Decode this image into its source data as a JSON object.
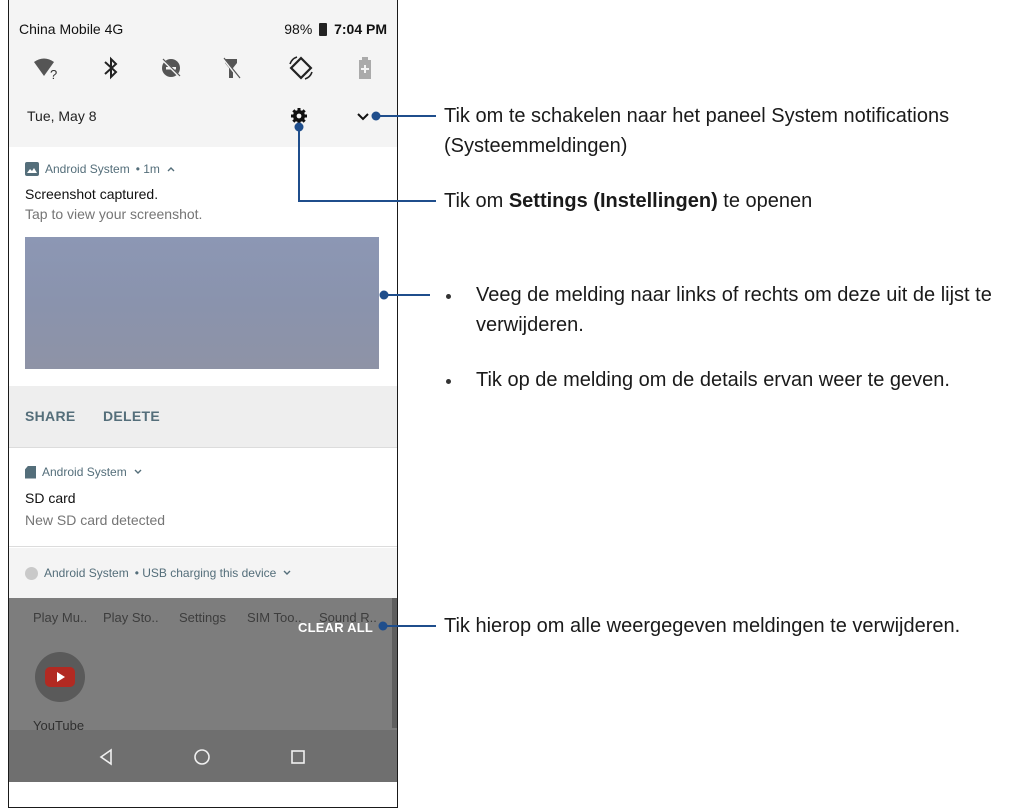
{
  "status_bar": {
    "carrier": "China Mobile 4G",
    "battery": "98%",
    "time": "7:04 PM"
  },
  "quick_settings": {
    "icons": [
      "wifi-question-icon",
      "bluetooth-icon",
      "do-not-disturb-off-icon",
      "flashlight-off-icon",
      "auto-rotate-icon",
      "battery-saver-icon"
    ],
    "wifi_badge": "?",
    "date": "Tue, May 8"
  },
  "notification_screenshot": {
    "app": "Android System",
    "meta": "• 1m",
    "title": "Screenshot captured.",
    "text": "Tap to view your screenshot.",
    "actions": [
      "SHARE",
      "DELETE"
    ]
  },
  "notification_sd": {
    "app": "Android System",
    "title": "SD card",
    "text": "New SD card detected"
  },
  "notification_usb": {
    "app": "Android System",
    "meta": "• USB charging this device"
  },
  "home": {
    "app_labels": [
      "Play Mu..",
      "Play Sto..",
      "Settings",
      "SIM Too..",
      "Sound R.."
    ],
    "clear_all": "CLEAR ALL",
    "youtube_label": "YouTube"
  },
  "callouts": {
    "expand_pre": "Tik om te schakelen naar het paneel System notifications",
    "expand_post": "(Systeemmeldingen)",
    "settings_pre": "Tik om ",
    "settings_bold": "Settings (Instellingen)",
    "settings_post": " te openen",
    "swipe_line1": "Veeg de melding naar links of rechts om deze uit de lijst te",
    "swipe_line2": "verwijderen.",
    "tap_detail": "Tik op de melding om de details ervan weer te geven.",
    "clear_all": "Tik hierop om alle weergegeven meldingen te verwijderen."
  },
  "colors": {
    "callout_line": "#1f4e8c",
    "notification_accent": "#546e7a",
    "dim_overlay": "#7d7d7d"
  }
}
